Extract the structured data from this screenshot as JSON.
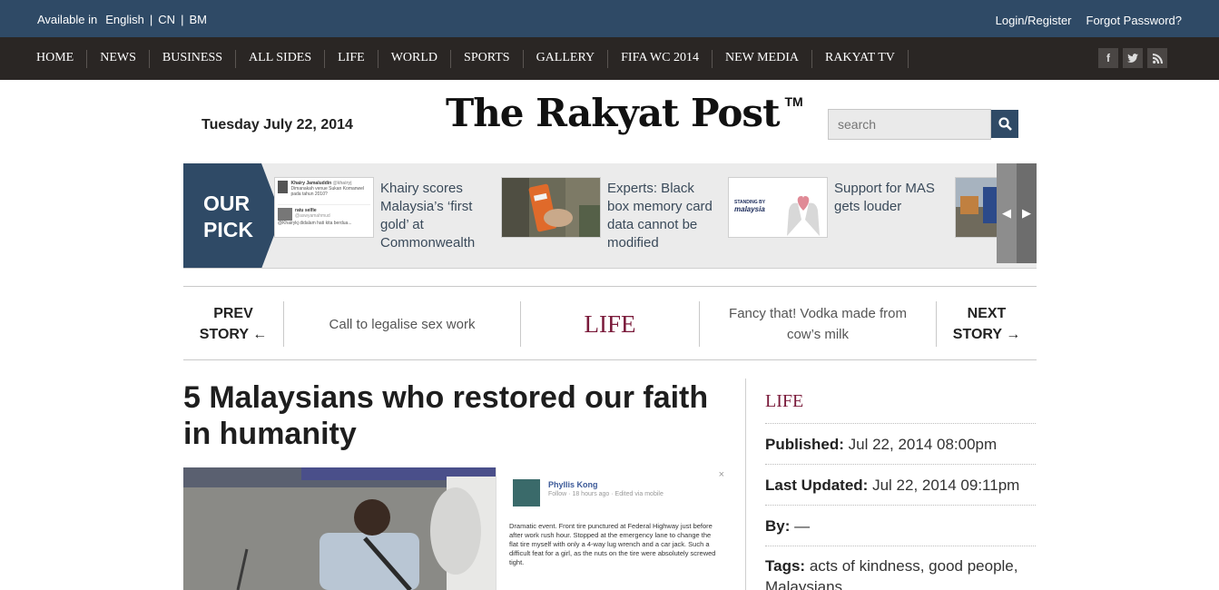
{
  "topbar": {
    "available_label": "Available in",
    "languages": [
      "English",
      "CN",
      "BM"
    ],
    "separator": "|",
    "login_label": "Login/Register",
    "forgot_label": "Forgot Password?"
  },
  "nav": {
    "items": [
      "HOME",
      "NEWS",
      "BUSINESS",
      "ALL SIDES",
      "LIFE",
      "WORLD",
      "SPORTS",
      "GALLERY",
      "FIFA WC 2014",
      "NEW MEDIA",
      "RAKYAT TV"
    ],
    "social": [
      "f",
      "t",
      "rss"
    ]
  },
  "masthead": {
    "date": "Tuesday July 22, 2014",
    "logo": "The Rakyat Post",
    "tm": "TM",
    "search_placeholder": "search"
  },
  "our_pick": {
    "label_line1": "OUR",
    "label_line2": "PICK",
    "items": [
      {
        "title": "Khairy scores Malaysia’s ‘first gold’ at Commonwealth",
        "thumb": {
          "tweet1_name": "Khairy Jamaluddin",
          "tweet1_handle": "@khairyj",
          "tweet1_text": "Dimanakah venue Sukan Komanwel pada tahun 2010?",
          "tweet2_name": "ratu selfie",
          "tweet2_handle": "@aswyamahmud",
          "tweet2_text": "@Khairykj didalam hati kita berdua..."
        }
      },
      {
        "title": "Experts: Black box memory card data cannot be modified"
      },
      {
        "title": "Support for MAS gets louder",
        "thumb": {
          "brand": "STANDING BY",
          "brand2": "malaysia"
        }
      }
    ],
    "arrow_prev": "◀",
    "arrow_next": "▶"
  },
  "story_nav": {
    "prev_line1": "PREV",
    "prev_line2": "STORY ←",
    "prev_title": "Call to legalise sex work",
    "category": "LIFE",
    "next_title": "Fancy that! Vodka made from cow’s milk",
    "next_line1": "NEXT",
    "next_line2": "STORY →"
  },
  "article": {
    "headline": "5 Malaysians who restored our faith in humanity",
    "fb_name": "Phyllis Kong",
    "fb_meta": "Follow · 18 hours ago · Edited via mobile",
    "fb_text": "Dramatic event. Front tire punctured at Federal Highway just before after work rush hour. Stopped at the emergency lane to change the flat tire myself with only a 4-way lug wrench and a car jack. Such a difficult feat for a girl, as the nuts on the tire were absolutely screwed tight.",
    "fb_close": "×"
  },
  "sidebar": {
    "category": "LIFE",
    "published_label": "Published:",
    "published_value": "Jul 22, 2014 08:00pm",
    "updated_label": "Last Updated:",
    "updated_value": "Jul 22, 2014 09:11pm",
    "by_label": "By:",
    "by_value": "—",
    "tags_label": "Tags:",
    "tags": [
      "acts of kindness",
      "good people",
      "Malaysians"
    ]
  },
  "colors": {
    "topbar": "#2f4a66",
    "navbar": "#2a2624",
    "accent_category": "#7a1a3a",
    "pick_badge": "#2f4a66"
  }
}
